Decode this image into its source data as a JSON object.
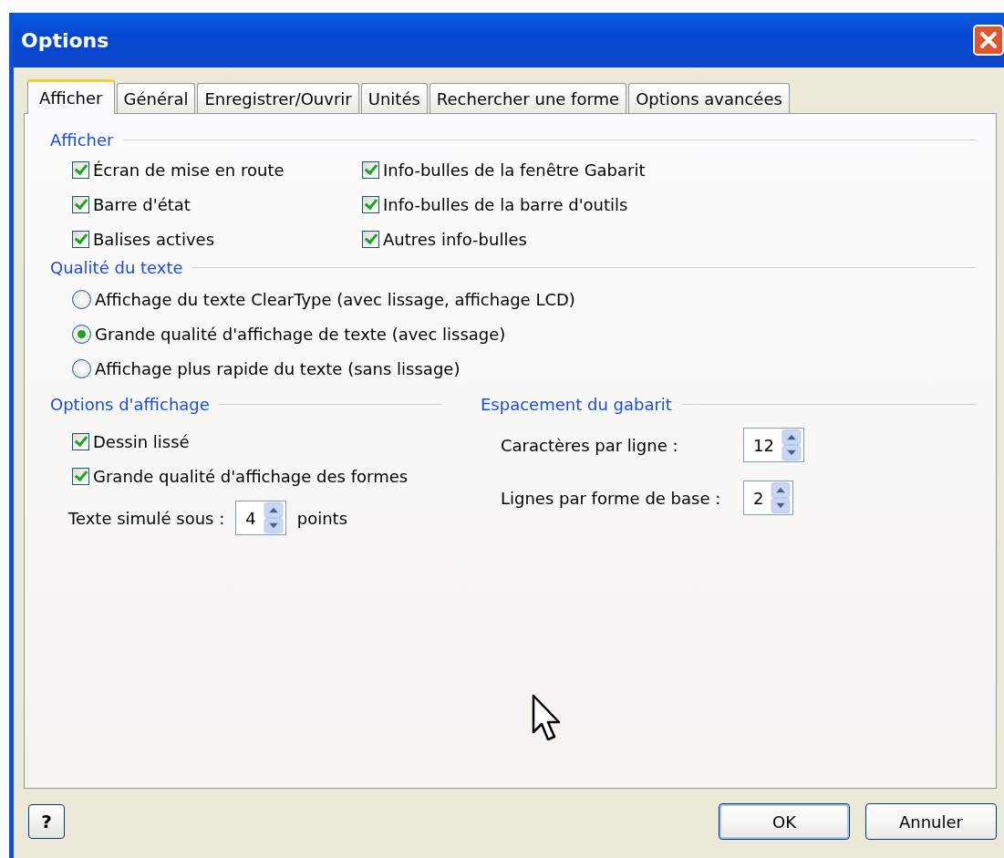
{
  "window": {
    "title": "Options"
  },
  "tabs": [
    {
      "label": "Afficher",
      "selected": true
    },
    {
      "label": "Général",
      "selected": false
    },
    {
      "label": "Enregistrer/Ouvrir",
      "selected": false
    },
    {
      "label": "Unités",
      "selected": false
    },
    {
      "label": "Rechercher une forme",
      "selected": false
    },
    {
      "label": "Options avancées",
      "selected": false
    }
  ],
  "display_group": {
    "title": "Afficher",
    "columns": [
      [
        {
          "label": "Écran de mise en route",
          "checked": true
        },
        {
          "label": "Barre d'état",
          "checked": true
        },
        {
          "label": "Balises actives",
          "checked": true
        }
      ],
      [
        {
          "label": "Info-bulles de la fenêtre Gabarit",
          "checked": true
        },
        {
          "label": "Info-bulles de la barre d'outils",
          "checked": true
        },
        {
          "label": "Autres info-bulles",
          "checked": true
        }
      ]
    ]
  },
  "text_quality": {
    "title": "Qualité du texte",
    "options": [
      {
        "label": "Affichage du texte ClearType (avec lissage, affichage LCD)",
        "selected": false
      },
      {
        "label": "Grande qualité d'affichage de texte (avec lissage)",
        "selected": true
      },
      {
        "label": "Affichage plus rapide du texte (sans lissage)",
        "selected": false
      }
    ]
  },
  "display_options": {
    "title": "Options d'affichage",
    "checkboxes": [
      {
        "label": "Dessin lissé",
        "checked": true
      },
      {
        "label": "Grande qualité d'affichage des formes",
        "checked": true
      }
    ],
    "spinner": {
      "label": "Texte simulé sous :",
      "value": "4",
      "unit": "points"
    }
  },
  "stencil_spacing": {
    "title": "Espacement du gabarit",
    "fields": [
      {
        "label": "Caractères par ligne :",
        "value": "12"
      },
      {
        "label": "Lignes par forme de base :",
        "value": "2"
      }
    ]
  },
  "help_button": {
    "text": "?"
  },
  "buttons": [
    {
      "label": "OK",
      "default": true
    },
    {
      "label": "Annuler",
      "default": false
    }
  ]
}
